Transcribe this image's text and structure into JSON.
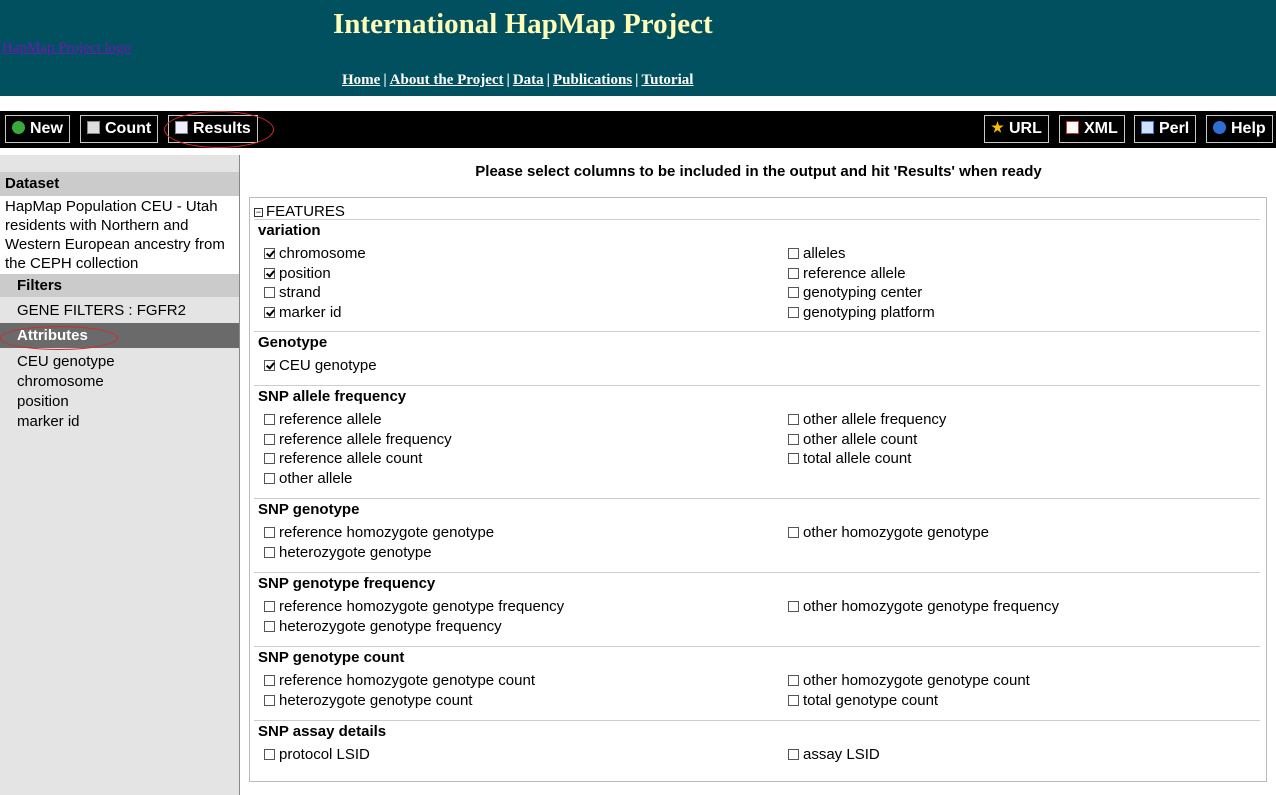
{
  "header": {
    "logo_alt": "HapMap Project logo",
    "title": "International HapMap Project",
    "nav": [
      "Home",
      "About the Project",
      "Data",
      "Publications",
      "Tutorial"
    ]
  },
  "toolbar": {
    "left": [
      {
        "label": "New",
        "icon": "refresh-icon"
      },
      {
        "label": "Count",
        "icon": "calculator-icon"
      },
      {
        "label": "Results",
        "icon": "table-icon"
      }
    ],
    "right": [
      {
        "label": "URL",
        "icon": "star-icon"
      },
      {
        "label": "XML",
        "icon": "xml-icon"
      },
      {
        "label": "Perl",
        "icon": "script-icon"
      },
      {
        "label": "Help",
        "icon": "help-icon"
      }
    ]
  },
  "sidebar": {
    "dataset_heading": "Dataset",
    "dataset_text": "HapMap Population CEU - Utah residents with Northern and Western European ancestry from the CEPH collection",
    "filters_heading": "Filters",
    "filters": [
      "GENE FILTERS : FGFR2"
    ],
    "attributes_heading": "Attributes",
    "attributes": [
      "CEU genotype",
      "chromosome",
      "position",
      "marker id"
    ]
  },
  "main": {
    "instruction": "Please select columns to be included in the output and hit 'Results' when ready",
    "group_label": "FEATURES",
    "sections": [
      {
        "title": "variation",
        "left": [
          {
            "label": "chromosome",
            "checked": true
          },
          {
            "label": "position",
            "checked": true
          },
          {
            "label": "strand",
            "checked": false
          },
          {
            "label": "marker id",
            "checked": true
          }
        ],
        "right": [
          {
            "label": "alleles",
            "checked": false
          },
          {
            "label": "reference allele",
            "checked": false
          },
          {
            "label": "genotyping center",
            "checked": false
          },
          {
            "label": "genotyping platform",
            "checked": false
          }
        ]
      },
      {
        "title": "Genotype",
        "left": [
          {
            "label": "CEU genotype",
            "checked": true
          }
        ],
        "right": []
      },
      {
        "title": "SNP allele frequency",
        "left": [
          {
            "label": "reference allele",
            "checked": false
          },
          {
            "label": "reference allele frequency",
            "checked": false
          },
          {
            "label": "reference allele count",
            "checked": false
          },
          {
            "label": "other allele",
            "checked": false
          }
        ],
        "right": [
          {
            "label": "other allele frequency",
            "checked": false
          },
          {
            "label": "other allele count",
            "checked": false
          },
          {
            "label": "total allele count",
            "checked": false
          }
        ]
      },
      {
        "title": "SNP genotype",
        "left": [
          {
            "label": "reference homozygote genotype",
            "checked": false
          },
          {
            "label": "heterozygote genotype",
            "checked": false
          }
        ],
        "right": [
          {
            "label": "other homozygote genotype",
            "checked": false
          }
        ]
      },
      {
        "title": "SNP genotype frequency",
        "left": [
          {
            "label": "reference homozygote genotype frequency",
            "checked": false
          },
          {
            "label": "heterozygote genotype frequency",
            "checked": false
          }
        ],
        "right": [
          {
            "label": "other homozygote genotype frequency",
            "checked": false
          }
        ]
      },
      {
        "title": "SNP genotype count",
        "left": [
          {
            "label": "reference homozygote genotype count",
            "checked": false
          },
          {
            "label": "heterozygote genotype count",
            "checked": false
          }
        ],
        "right": [
          {
            "label": "other homozygote genotype count",
            "checked": false
          },
          {
            "label": "total genotype count",
            "checked": false
          }
        ]
      },
      {
        "title": "SNP assay details",
        "left": [
          {
            "label": "protocol LSID",
            "checked": false
          }
        ],
        "right": [
          {
            "label": "assay LSID",
            "checked": false
          }
        ]
      }
    ]
  },
  "colors": {
    "header_bg": "#00505f",
    "title_color": "#fffdb8",
    "toolbar_bg": "#000000",
    "annotation_red": "#d42a2a"
  }
}
